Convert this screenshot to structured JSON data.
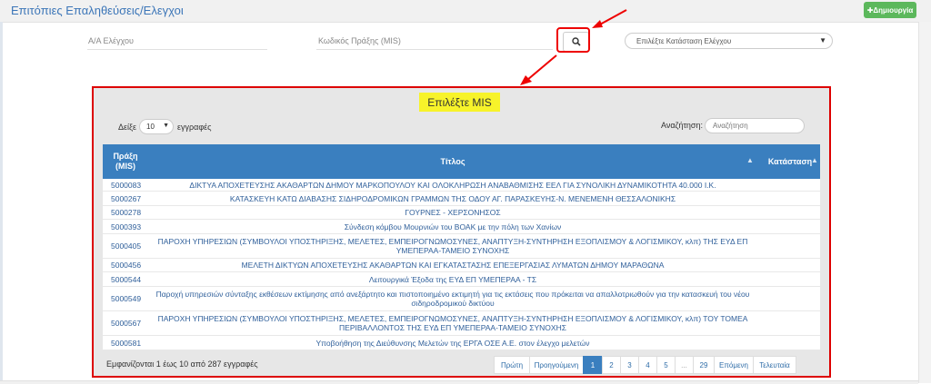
{
  "header": {
    "title": "Επιτόπιες Επαληθεύσεις/Ελεγχοι",
    "create_label": "✚Δημιουργία"
  },
  "filters": {
    "aa_label": "Α/Α Ελέγχου",
    "mis_label": "Κωδικός Πράξης (MIS)",
    "status_select": "Επιλέξτε Κατάσταση Ελέγχου"
  },
  "icons": {
    "search": "search-icon",
    "caret": "chevron-down-icon",
    "sort": "sort-icon"
  },
  "colors": {
    "accent": "#3a7fbf",
    "create": "#5cb85c",
    "highlight": "#f7f32a",
    "annotation": "#dd0000"
  },
  "modal": {
    "title": "Επιλέξτε MIS",
    "show_label": "Δείξε",
    "page_length": "10",
    "records_label": "εγγραφές",
    "search_label": "Αναζήτηση:",
    "search_placeholder": "Αναζήτηση",
    "columns": [
      "Πράξη (MIS)",
      "Τίτλος",
      "Κατάσταση"
    ],
    "rows": [
      {
        "code": "5000083",
        "title": "ΔΙΚΤΥΑ ΑΠΟΧΕΤΕΥΣΗΣ ΑΚΑΘΑΡΤΩΝ ΔΗΜΟΥ ΜΑΡΚΟΠΟΥΛΟΥ ΚΑΙ ΟΛΟΚΛΗΡΩΣΗ ΑΝΑΒΑΘΜΙΣΗΣ ΕΕΛ ΓΙΑ ΣΥΝΟΛΙΚΗ ΔΥΝΑΜΙΚΟΤΗΤΑ 40.000 Ι.Κ."
      },
      {
        "code": "5000267",
        "title": "ΚΑΤΑΣΚΕΥΗ ΚΑΤΩ ΔΙΑΒΑΣΗΣ ΣΙΔΗΡΟΔΡΟΜΙΚΩΝ ΓΡΑΜΜΩΝ ΤΗΣ ΟΔΟΥ ΑΓ. ΠΑΡΑΣΚΕΥΗΣ-Ν. ΜΕΝΕΜΕΝΗ ΘΕΣΣΑΛΟΝΙΚΗΣ"
      },
      {
        "code": "5000278",
        "title": "ΓΟΥΡΝΕΣ - ΧΕΡΣΟΝΗΣΟΣ"
      },
      {
        "code": "5000393",
        "title": "Σύνδεση κόμβου Μουρνιών του ΒΟΑΚ με την πόλη των Χανίων"
      },
      {
        "code": "5000405",
        "title": "ΠΑΡΟΧΗ ΥΠΗΡΕΣΙΩΝ (ΣΥΜΒΟΥΛΟΙ ΥΠΟΣΤΗΡΙΞΗΣ, ΜΕΛΕΤΕΣ, ΕΜΠΕΙΡΟΓΝΩΜΟΣΥΝΕΣ, ΑΝΑΠΤΥΞΗ-ΣΥΝΤΗΡΗΣΗ ΕΞΟΠΛΙΣΜΟΥ & ΛΟΓΙΣΜΙΚΟΥ, κλπ) ΤΗΣ ΕΥΔ ΕΠ ΥΜΕΠΕΡΑΑ-ΤΑΜΕΙΟ ΣΥΝΟΧΗΣ"
      },
      {
        "code": "5000456",
        "title": "ΜΕΛΕΤΗ ΔΙΚΤΥΩΝ ΑΠΟΧΕΤΕΥΣΗΣ ΑΚΑΘΑΡΤΩΝ ΚΑΙ ΕΓΚΑΤΑΣΤΑΣΗΣ ΕΠΕΞΕΡΓΑΣΙΑΣ ΛΥΜΑΤΩΝ ΔΗΜΟΥ ΜΑΡΑΘΩΝΑ"
      },
      {
        "code": "5000544",
        "title": "Λειτουργικά Έξοδα της ΕΥΔ ΕΠ ΥΜΕΠΕΡΑΑ - ΤΣ"
      },
      {
        "code": "5000549",
        "title": "Παροχή υπηρεσιών σύνταξης εκθέσεων εκτίμησης από ανεξάρτητο και πιστοποιημένο εκτιμητή για τις εκτάσεις που πρόκειται να απαλλοτριωθούν για την κατασκευή του νέου σιδηροδρομικού δικτύου"
      },
      {
        "code": "5000567",
        "title": "ΠΑΡΟΧΗ ΥΠΗΡΕΣΙΩΝ (ΣΥΜΒΟΥΛΟΙ ΥΠΟΣΤΗΡΙΞΗΣ, ΜΕΛΕΤΕΣ, ΕΜΠΕΙΡΟΓΝΩΜΟΣΥΝΕΣ, ΑΝΑΠΤΥΞΗ-ΣΥΝΤΗΡΗΣΗ ΕΞΟΠΛΙΣΜΟΥ & ΛΟΓΙΣΜΙΚΟΥ, κλπ) ΤΟΥ ΤΟΜΕΑ ΠΕΡΙΒΑΛΛΟΝΤΟΣ ΤΗΣ ΕΥΔ ΕΠ ΥΜΕΠΕΡΑΑ-ΤΑΜΕΙΟ ΣΥΝΟΧΗΣ"
      },
      {
        "code": "5000581",
        "title": "Υποβοήθηση της Διεύθυνσης Μελετών της ΕΡΓΑ ΟΣΕ Α.Ε. στον έλεγχο μελετών"
      }
    ],
    "info": "Εμφανίζονται 1 έως 10 από 287 εγγραφές",
    "pagination": [
      "Πρώτη",
      "Προηγούμενη",
      "1",
      "2",
      "3",
      "4",
      "5",
      "...",
      "29",
      "Επόμενη",
      "Τελευταία"
    ],
    "active_page": "1"
  }
}
